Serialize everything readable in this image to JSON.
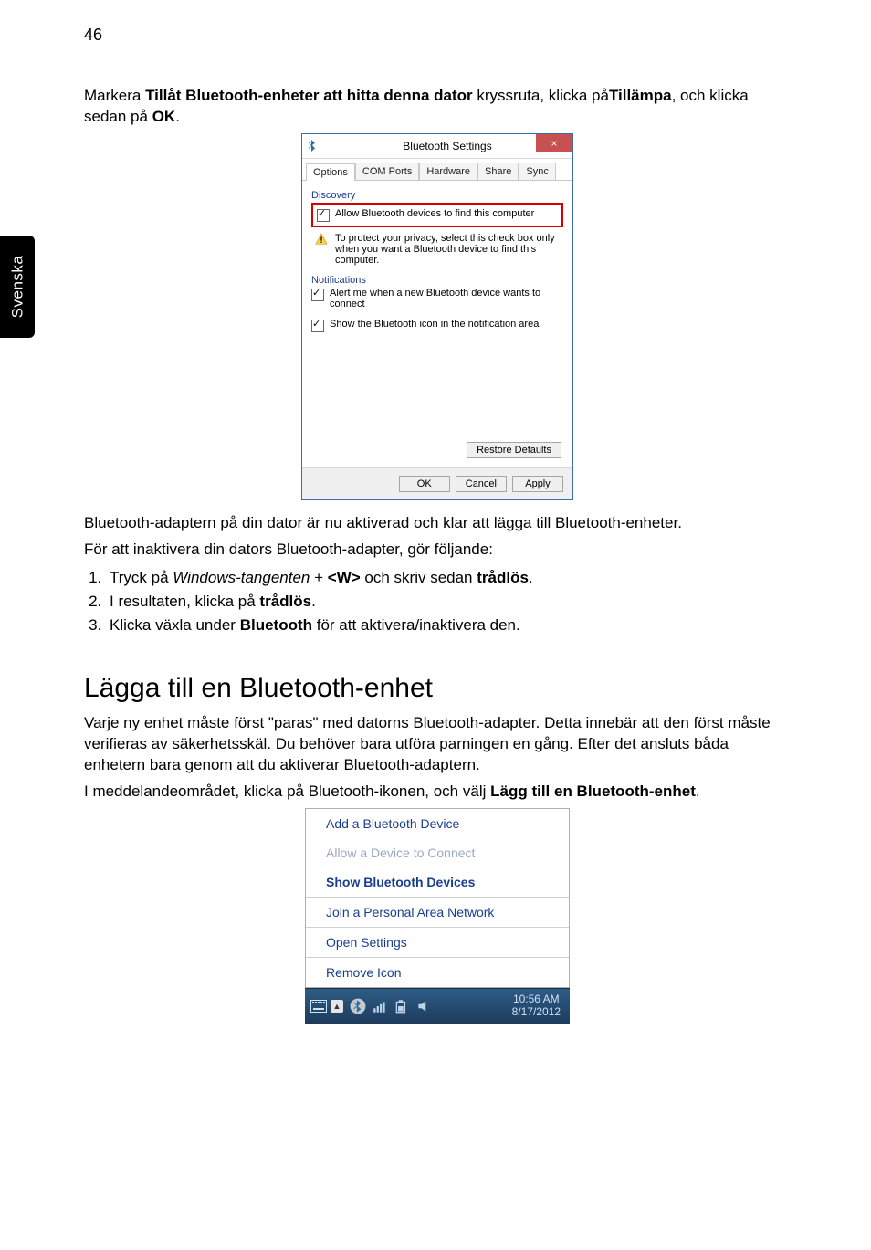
{
  "page_number": "46",
  "side_tab": "Svenska",
  "intro": {
    "pre": "Markera ",
    "bold1": "Tillåt Bluetooth-enheter att hitta denna dator",
    "mid1": " kryssruta, klicka på",
    "bold2": "Tillämpa",
    "mid2": ", och klicka sedan på ",
    "bold3": "OK",
    "end": "."
  },
  "dialog": {
    "title": "Bluetooth Settings",
    "tabs": [
      "Options",
      "COM Ports",
      "Hardware",
      "Share",
      "Sync"
    ],
    "discovery_label": "Discovery",
    "allow_label": "Allow Bluetooth devices to find this computer",
    "warning": "To protect your privacy, select this check box only when you want a Bluetooth device to find this computer.",
    "notifications_label": "Notifications",
    "alert_label": "Alert me when a new Bluetooth device wants to connect",
    "show_icon_label": "Show the Bluetooth icon in the notification area",
    "restore": "Restore Defaults",
    "ok": "OK",
    "cancel": "Cancel",
    "apply": "Apply"
  },
  "after_dialog": "Bluetooth-adaptern på din dator är nu aktiverad och klar att lägga till Bluetooth-enheter.",
  "disable_intro": "För att inaktivera din dators Bluetooth-adapter, gör följande:",
  "steps": {
    "s1_pre": "Tryck på ",
    "s1_it": "Windows-tangenten",
    "s1_mid": " + ",
    "s1_key": "<W>",
    "s1_mid2": " och skriv sedan ",
    "s1_b": "trådlös",
    "s1_end": ".",
    "s2_pre": "I resultaten, klicka på ",
    "s2_b": "trådlös",
    "s2_end": ".",
    "s3_pre": "Klicka växla under ",
    "s3_b": "Bluetooth",
    "s3_end": " för att aktivera/inaktivera den."
  },
  "h2": "Lägga till en Bluetooth-enhet",
  "para1": "Varje ny enhet måste först \"paras\" med datorns Bluetooth-adapter. Detta innebär att den först måste verifieras av säkerhetsskäl. Du behöver bara utföra parningen en gång. Efter det ansluts båda enhetern bara genom att du aktiverar Bluetooth-adaptern.",
  "para2_pre": "I meddelandeområdet, klicka på Bluetooth-ikonen, och välj ",
  "para2_b": "Lägg till en Bluetooth-enhet",
  "para2_end": ".",
  "tray_menu": {
    "add": "Add a Bluetooth Device",
    "allow": "Allow a Device to Connect",
    "show": "Show Bluetooth Devices",
    "join": "Join a Personal Area Network",
    "open": "Open Settings",
    "remove": "Remove Icon"
  },
  "taskbar": {
    "time": "10:56 AM",
    "date": "8/17/2012"
  }
}
